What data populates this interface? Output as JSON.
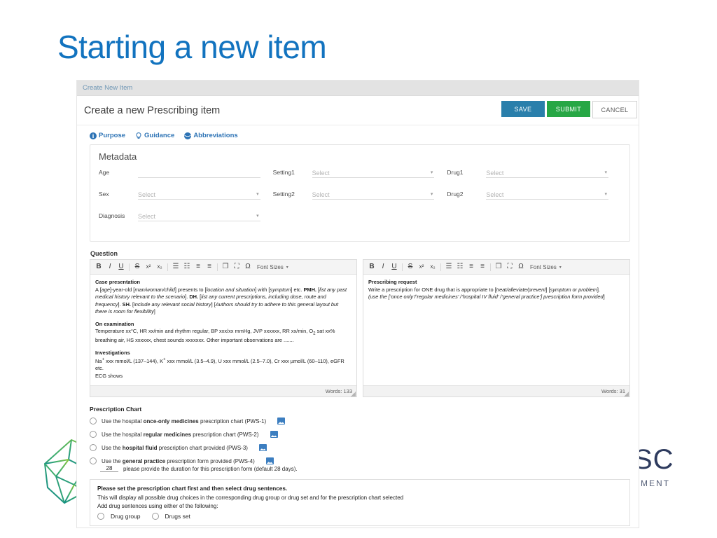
{
  "slide": {
    "title": "Starting a new item"
  },
  "logos": {
    "left_name": "polyhedron-logo",
    "right_text": "SC",
    "right_subtext": "SMENT"
  },
  "app": {
    "breadcrumb": "Create New Item",
    "page_title": "Create a new Prescribing item",
    "buttons": {
      "save": "SAVE",
      "submit": "SUBMIT",
      "cancel": "CANCEL"
    },
    "colors": {
      "save_bg": "#2a7fab",
      "submit_bg": "#27a745",
      "cancel_bg": "#ffffff",
      "link_blue": "#2d73b5",
      "breadcrumb_bg": "#e3e3e3"
    },
    "helpers": [
      {
        "label": "Purpose",
        "icon": "info-icon"
      },
      {
        "label": "Guidance",
        "icon": "lightbulb-icon"
      },
      {
        "label": "Abbreviations",
        "icon": "globe-icon"
      }
    ]
  },
  "metadata": {
    "heading": "Metadata",
    "fields": [
      {
        "label": "Age",
        "value": "",
        "placeholder": "",
        "type": "text"
      },
      {
        "label": "Sex",
        "value": "",
        "placeholder": "Select",
        "type": "select"
      },
      {
        "label": "Diagnosis",
        "value": "",
        "placeholder": "Select",
        "type": "select"
      },
      {
        "label": "Setting1",
        "value": "",
        "placeholder": "Select",
        "type": "select"
      },
      {
        "label": "Setting2",
        "value": "",
        "placeholder": "Select",
        "type": "select"
      },
      {
        "label": "Drug1",
        "value": "",
        "placeholder": "Select",
        "type": "select"
      },
      {
        "label": "Drug2",
        "value": "",
        "placeholder": "Select",
        "type": "select"
      }
    ]
  },
  "question": {
    "section_label": "Question",
    "toolbar": {
      "bold": "B",
      "italic": "I",
      "underline": "U",
      "strike": "S",
      "superscript": "x²",
      "subscript": "x₂",
      "bullet_list": "☰",
      "number_list": "☷",
      "align_left": "≡",
      "align_center": "≡",
      "paste": "❐",
      "fullscreen": "⛶",
      "omega": "Ω",
      "font_sizes": "Font Sizes"
    },
    "left_editor": {
      "blocks": [
        {
          "heading": "Case presentation",
          "html": "A [<i>age</i>]-year-old [<i>man/woman/child</i>] presents to [<i>location and situation</i>] with [<i>symptom</i>] etc. <b>PMH.</b> [<i>list any past medical history relevant to the scenario</i>]. <b>DH.</b> [<i>list any current prescriptions, including dose, route and frequency</i>]. <b>SH.</b> [<i>include any relevant social history</i>] [<i>Authors should try to adhere to this general layout but there is room for flexibility</i>]"
        },
        {
          "heading": "On examination",
          "html": "Temperature xx°C, HR xx/min and rhythm regular, BP xxx/xx mmHg, JVP xxxxxx, RR xx/min, O<sub>2</sub> sat xx% breathing air, HS xxxxxx, chest sounds xxxxxxx. Other important observations are ......."
        },
        {
          "heading": "Investigations",
          "html": "Na<sup>+</sup> xxx mmol/L (137–144), K<sup>+</sup> xxx mmol/L (3.5–4.9), U xxx mmol/L (2.5–7.0), Cr xxx µmol/L (60–110), eGFR etc.<br>ECG shows"
        }
      ],
      "word_count": "Words: 133"
    },
    "right_editor": {
      "blocks": [
        {
          "heading": "Prescribing request",
          "html": "Write a prescription for ONE drug that is appropriate to [<i>treat/alleviate/prevent</i>] [<i>symptom or problem</i>].<br><i>(use the [‘once only’/‘regular medicines’ /‘hospital IV fluid’ /‘general practice’] prescription form provided</i>]"
        }
      ],
      "word_count": "Words: 31"
    }
  },
  "prescription_chart": {
    "heading": "Prescription Chart",
    "options": [
      {
        "pre": "Use the hospital ",
        "strong": "once-only medicines",
        "post": " prescription chart (PWS-1)",
        "selected": false
      },
      {
        "pre": "Use the hospital ",
        "strong": "regular medicines",
        "post": " prescription chart (PWS-2)",
        "selected": false
      },
      {
        "pre": "Use the ",
        "strong": "hospital fluid",
        "post": " prescription chart provided (PWS-3)",
        "selected": false
      },
      {
        "pre": "Use the ",
        "strong": "general practice",
        "post": " prescription form provided (PWS-4)",
        "selected": false
      }
    ],
    "duration_value": "28",
    "duration_note": "please provide the duration for this prescription form (default 28 days)."
  },
  "drug_sentences": {
    "title": "Please set the prescription chart first and then select drug sentences.",
    "line1": "This will display all possible drug choices in the corresponding drug group or drug set and for the prescription chart selected",
    "line2": "Add drug sentences using either of the following:",
    "options": [
      {
        "label": "Drug group",
        "selected": false
      },
      {
        "label": "Drugs set",
        "selected": false
      }
    ]
  }
}
